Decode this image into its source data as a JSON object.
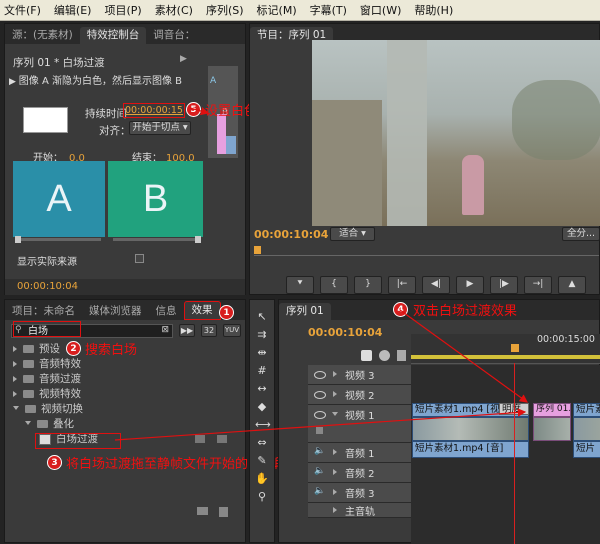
{
  "menu": [
    "文件(F)",
    "编辑(E)",
    "项目(P)",
    "素材(C)",
    "序列(S)",
    "标记(M)",
    "字幕(T)",
    "窗口(W)",
    "帮助(H)"
  ],
  "effect_controls": {
    "tabs": [
      "源：(无素材)",
      "特效控制台",
      "调音台："
    ],
    "sequence_label": "序列 01 * 白场过渡",
    "ruler_mark": "▶",
    "description": "图像 A 渐隐为白色，然后显示图像 B",
    "side_letters": [
      "A",
      "B"
    ],
    "duration_label": "持续时间",
    "duration_value": "00:00:00:15",
    "align_label": "对齐：",
    "align_value": "开始于切点",
    "start_label": "开始：",
    "start_value": "0.0",
    "end_label": "结束：",
    "end_value": "100.0",
    "letter_a": "A",
    "letter_b": "B",
    "show_source_label": "显示实际来源",
    "timecode": "00:00:10:04"
  },
  "program_monitor": {
    "title": "节目：序列 01",
    "timecode": "00:00:10:04",
    "fit_label": "适合",
    "full_label": "全分..."
  },
  "project_panel": {
    "tabs": [
      "项目：未命名",
      "媒体浏览器",
      "信息",
      "效果"
    ],
    "search_value": "白场",
    "icon_labels": [
      "32",
      "YUV"
    ],
    "tree": [
      {
        "label": "预设",
        "indent": 0,
        "open": false,
        "folder": true
      },
      {
        "label": "音频特效",
        "indent": 0,
        "open": false,
        "folder": true
      },
      {
        "label": "音频过渡",
        "indent": 0,
        "open": false,
        "folder": true
      },
      {
        "label": "视频特效",
        "indent": 0,
        "open": false,
        "folder": true
      },
      {
        "label": "视频切换",
        "indent": 0,
        "open": true,
        "folder": true
      },
      {
        "label": "叠化",
        "indent": 1,
        "open": true,
        "folder": true
      },
      {
        "label": "白场过渡",
        "indent": 2,
        "open": false,
        "folder": false
      }
    ]
  },
  "timeline": {
    "tab": "序列 01",
    "timecode": "00:00:10:04",
    "ruler_time": "00:00:15:00",
    "tracks": [
      {
        "name": "视频 3",
        "type": "video"
      },
      {
        "name": "视频 2",
        "type": "video"
      },
      {
        "name": "视频 1",
        "type": "video"
      },
      {
        "name": "音频 1",
        "type": "audio"
      },
      {
        "name": "音频 2",
        "type": "audio"
      },
      {
        "name": "音频 3",
        "type": "audio"
      },
      {
        "name": "主音轨",
        "type": "master"
      }
    ],
    "clip_video1": "短片素材1.mp4 [视]",
    "transition_label": "明度",
    "clip_seq": "序列 01.",
    "clip_video_end": "短片素",
    "clip_audio1": "短片素材1.mp4 [音]",
    "clip_audio_end": "短片"
  },
  "annotations": {
    "step1": "1",
    "step2": "2",
    "step2_text": "搜索白场",
    "step3": "3",
    "step3_text": "将白场过渡拖至静帧文件开始的时间段",
    "step4": "4",
    "step4_text": "双击白场过渡效果",
    "step5": "5",
    "step5_text": "设置白色闪光的持续时间"
  },
  "colors": {
    "accent_orange": "#e8a33a",
    "annotation_red": "#e01010",
    "clip_blue": "#7fa5cf",
    "transition_pink": "#e7a0e0",
    "panel_teal": "#2a8fa8",
    "panel_green": "#21a27e"
  }
}
